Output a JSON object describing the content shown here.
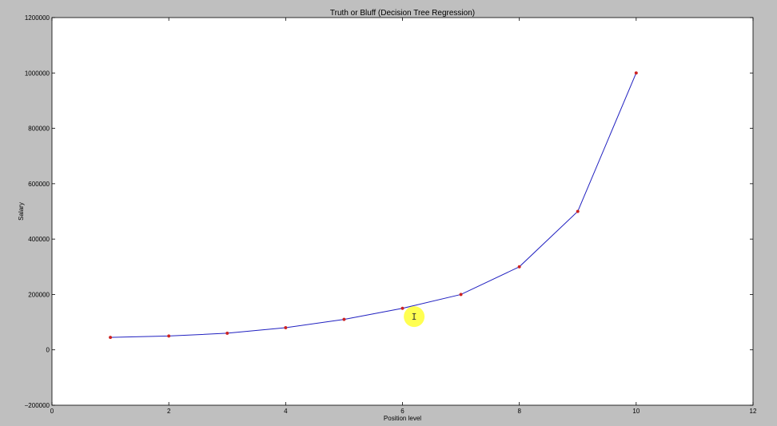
{
  "chart_data": {
    "type": "line",
    "title": "Truth or Bluff (Decision Tree Regression)",
    "xlabel": "Position level",
    "ylabel": "Salary",
    "xlim": [
      0,
      12
    ],
    "ylim": [
      -200000,
      1200000
    ],
    "x_ticks": [
      0,
      2,
      4,
      6,
      8,
      10,
      12
    ],
    "y_ticks": [
      -200000,
      0,
      200000,
      400000,
      600000,
      800000,
      1000000,
      1200000
    ],
    "x_tick_labels": [
      "0",
      "2",
      "4",
      "6",
      "8",
      "10",
      "12"
    ],
    "y_tick_labels": [
      "−200000",
      "0",
      "200000",
      "400000",
      "600000",
      "800000",
      "1000000",
      "1200000"
    ],
    "grid": false,
    "series": [
      {
        "name": "",
        "line_color": "#2020c0",
        "marker_color": "#cc2222",
        "x": [
          1,
          2,
          3,
          4,
          5,
          6,
          7,
          8,
          9,
          10
        ],
        "y": [
          45000,
          50000,
          60000,
          80000,
          110000,
          150000,
          200000,
          300000,
          500000,
          1000000
        ]
      }
    ]
  },
  "cursor": {
    "highlight_color": "#ffff33",
    "icon": "text-cursor-icon",
    "glyph": "I",
    "x": 6.2,
    "y": 120000
  }
}
